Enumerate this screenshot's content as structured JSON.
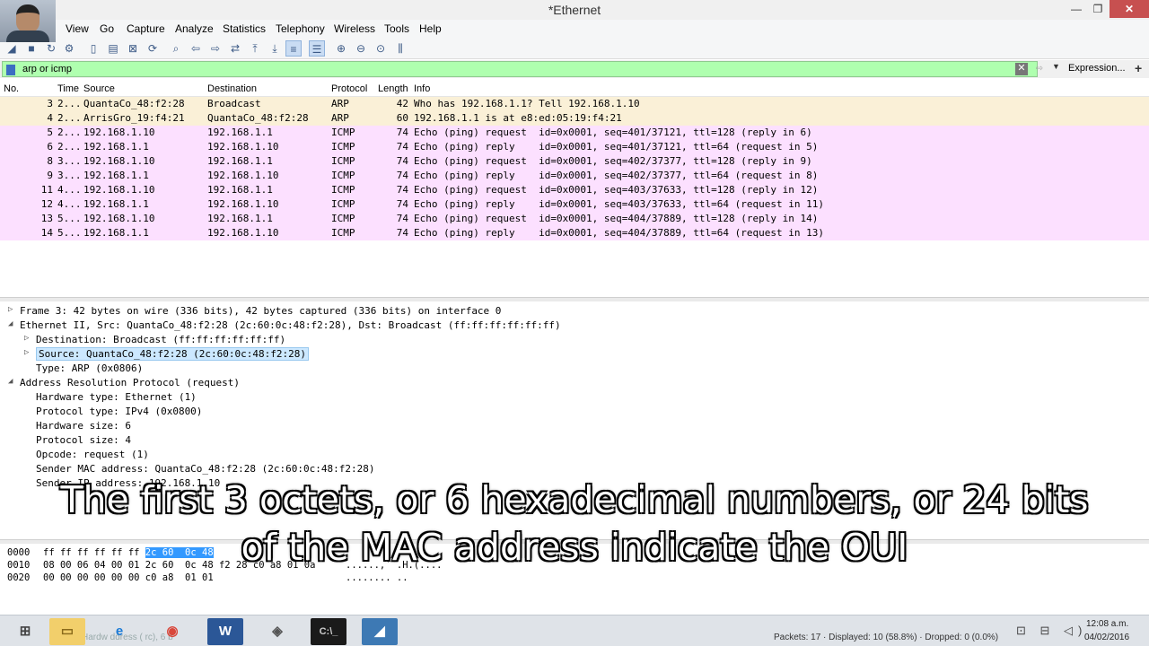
{
  "window": {
    "title": "*Ethernet",
    "controls": {
      "minimize": "—",
      "maximize": "❐",
      "close": "✕"
    }
  },
  "menu": [
    "View",
    "Go",
    "Capture",
    "Analyze",
    "Statistics",
    "Telephony",
    "Wireless",
    "Tools",
    "Help"
  ],
  "filter": {
    "value": "arp or icmp",
    "expression_label": "Expression...",
    "add_label": "+",
    "clear_label": "✕",
    "apply_label": "⇨",
    "dropdown_label": "▼"
  },
  "packet_list": {
    "columns": [
      "No.",
      "Time",
      "Source",
      "Destination",
      "Protocol",
      "Length",
      "Info"
    ],
    "rows": [
      {
        "no": "3",
        "time": "2...",
        "src": "QuantaCo_48:f2:28",
        "dst": "Broadcast",
        "proto": "ARP",
        "len": "42",
        "info": "Who has 192.168.1.1? Tell 192.168.1.10",
        "bg": "#faf0d7"
      },
      {
        "no": "4",
        "time": "2...",
        "src": "ArrisGro_19:f4:21",
        "dst": "QuantaCo_48:f2:28",
        "proto": "ARP",
        "len": "60",
        "info": "192.168.1.1 is at e8:ed:05:19:f4:21",
        "bg": "#faf0d7"
      },
      {
        "no": "5",
        "time": "2...",
        "src": "192.168.1.10",
        "dst": "192.168.1.1",
        "proto": "ICMP",
        "len": "74",
        "info": "Echo (ping) request  id=0x0001, seq=401/37121, ttl=128 (reply in 6)",
        "bg": "#fce0ff"
      },
      {
        "no": "6",
        "time": "2...",
        "src": "192.168.1.1",
        "dst": "192.168.1.10",
        "proto": "ICMP",
        "len": "74",
        "info": "Echo (ping) reply    id=0x0001, seq=401/37121, ttl=64 (request in 5)",
        "bg": "#fce0ff"
      },
      {
        "no": "8",
        "time": "3...",
        "src": "192.168.1.10",
        "dst": "192.168.1.1",
        "proto": "ICMP",
        "len": "74",
        "info": "Echo (ping) request  id=0x0001, seq=402/37377, ttl=128 (reply in 9)",
        "bg": "#fce0ff"
      },
      {
        "no": "9",
        "time": "3...",
        "src": "192.168.1.1",
        "dst": "192.168.1.10",
        "proto": "ICMP",
        "len": "74",
        "info": "Echo (ping) reply    id=0x0001, seq=402/37377, ttl=64 (request in 8)",
        "bg": "#fce0ff"
      },
      {
        "no": "11",
        "time": "4...",
        "src": "192.168.1.10",
        "dst": "192.168.1.1",
        "proto": "ICMP",
        "len": "74",
        "info": "Echo (ping) request  id=0x0001, seq=403/37633, ttl=128 (reply in 12)",
        "bg": "#fce0ff"
      },
      {
        "no": "12",
        "time": "4...",
        "src": "192.168.1.1",
        "dst": "192.168.1.10",
        "proto": "ICMP",
        "len": "74",
        "info": "Echo (ping) reply    id=0x0001, seq=403/37633, ttl=64 (request in 11)",
        "bg": "#fce0ff"
      },
      {
        "no": "13",
        "time": "5...",
        "src": "192.168.1.10",
        "dst": "192.168.1.1",
        "proto": "ICMP",
        "len": "74",
        "info": "Echo (ping) request  id=0x0001, seq=404/37889, ttl=128 (reply in 14)",
        "bg": "#fce0ff"
      },
      {
        "no": "14",
        "time": "5...",
        "src": "192.168.1.1",
        "dst": "192.168.1.10",
        "proto": "ICMP",
        "len": "74",
        "info": "Echo (ping) reply    id=0x0001, seq=404/37889, ttl=64 (request in 13)",
        "bg": "#fce0ff"
      }
    ]
  },
  "details": [
    {
      "arrow": "▷",
      "indent": 0,
      "text": "Frame 3: 42 bytes on wire (336 bits), 42 bytes captured (336 bits) on interface 0",
      "selected": false
    },
    {
      "arrow": "◢",
      "indent": 0,
      "text": "Ethernet II, Src: QuantaCo_48:f2:28 (2c:60:0c:48:f2:28), Dst: Broadcast (ff:ff:ff:ff:ff:ff)",
      "selected": false
    },
    {
      "arrow": "▷",
      "indent": 1,
      "text": "Destination: Broadcast (ff:ff:ff:ff:ff:ff)",
      "selected": false
    },
    {
      "arrow": "▷",
      "indent": 1,
      "text": "Source: QuantaCo_48:f2:28 (2c:60:0c:48:f2:28)",
      "selected": true
    },
    {
      "arrow": "",
      "indent": 1,
      "text": "Type: ARP (0x0806)",
      "selected": false
    },
    {
      "arrow": "◢",
      "indent": 0,
      "text": "Address Resolution Protocol (request)",
      "selected": false
    },
    {
      "arrow": "",
      "indent": 1,
      "text": "Hardware type: Ethernet (1)",
      "selected": false
    },
    {
      "arrow": "",
      "indent": 1,
      "text": "Protocol type: IPv4 (0x0800)",
      "selected": false
    },
    {
      "arrow": "",
      "indent": 1,
      "text": "Hardware size: 6",
      "selected": false
    },
    {
      "arrow": "",
      "indent": 1,
      "text": "Protocol size: 4",
      "selected": false
    },
    {
      "arrow": "",
      "indent": 1,
      "text": "Opcode: request (1)",
      "selected": false
    },
    {
      "arrow": "",
      "indent": 1,
      "text": "Sender MAC address: QuantaCo_48:f2:28 (2c:60:0c:48:f2:28)",
      "selected": false
    },
    {
      "arrow": "",
      "indent": 1,
      "text": "Sender IP address: 192.168.1.10",
      "selected": false
    }
  ],
  "bytes": [
    {
      "offset": "0000",
      "pre": "ff ff ff ff ff ff ",
      "hl": "2c 60  0c 48",
      "post": "",
      "ascii": ""
    },
    {
      "offset": "0010",
      "pre": "08 00 06 04 00 01 2c 60  0c 48 f2 28 c0 a8 01 0a",
      "hl": "",
      "post": "",
      "ascii": "......,` .H.(...."
    },
    {
      "offset": "0020",
      "pre": "00 00 00 00 00 00 c0 a8  01 01",
      "hl": "",
      "post": "",
      "ascii": "........ .."
    }
  ],
  "subtitle": {
    "line1": "The first 3 octets, or 6 hexadecimal numbers, or 24 bits",
    "line2": "of the MAC address indicate the OUI"
  },
  "status": {
    "packets": "Packets: 17 · Displayed: 10 (58.8%) · Dropped: 0 (0.0%)",
    "ghost": "Hardw       ddress (   rc), 6 b"
  },
  "taskbar": {
    "start": "⊞",
    "explorer": "▭",
    "ie": "e",
    "chrome": "◉",
    "word": "W",
    "app": "◈",
    "cmd": "C:\\_",
    "shark": "◢",
    "tray": "⊡ ⊟ ◁)",
    "time": "12:08 a.m.",
    "date": "04/02/2016"
  },
  "colors": {
    "arp_row": "#faf0d7",
    "icmp_row": "#fce0ff",
    "filter_bg": "#afffaf",
    "selection": "#cce8ff"
  }
}
